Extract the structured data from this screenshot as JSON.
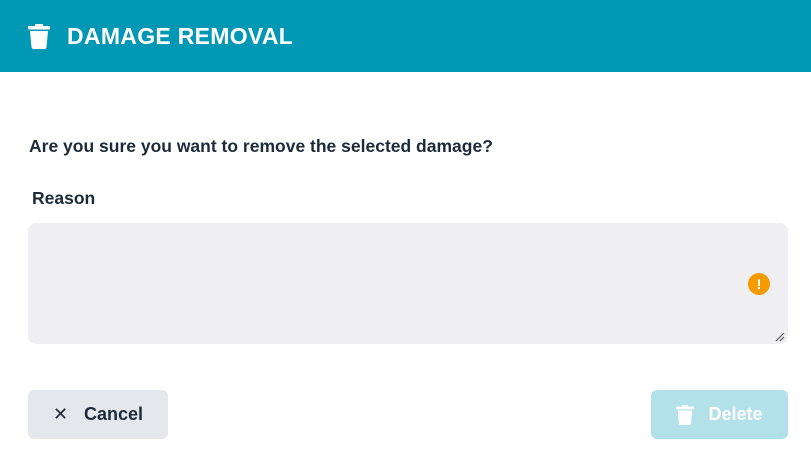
{
  "dialog": {
    "title": "DAMAGE REMOVAL",
    "title_icon": "trash-icon",
    "question": "Are you sure you want to remove the selected damage?",
    "reason_label": "Reason",
    "reason_value": "",
    "warning_icon": "exclamation-icon",
    "cancel_label": "Cancel",
    "cancel_icon": "close-icon",
    "delete_label": "Delete",
    "delete_icon": "trash-icon"
  },
  "colors": {
    "header_bg": "#0098b5",
    "text": "#1c2b3a",
    "textarea_bg": "#efeff1",
    "warning": "#f59b00",
    "cancel_bg": "#e4e8ec",
    "delete_bg_disabled": "#b3e1ea"
  }
}
